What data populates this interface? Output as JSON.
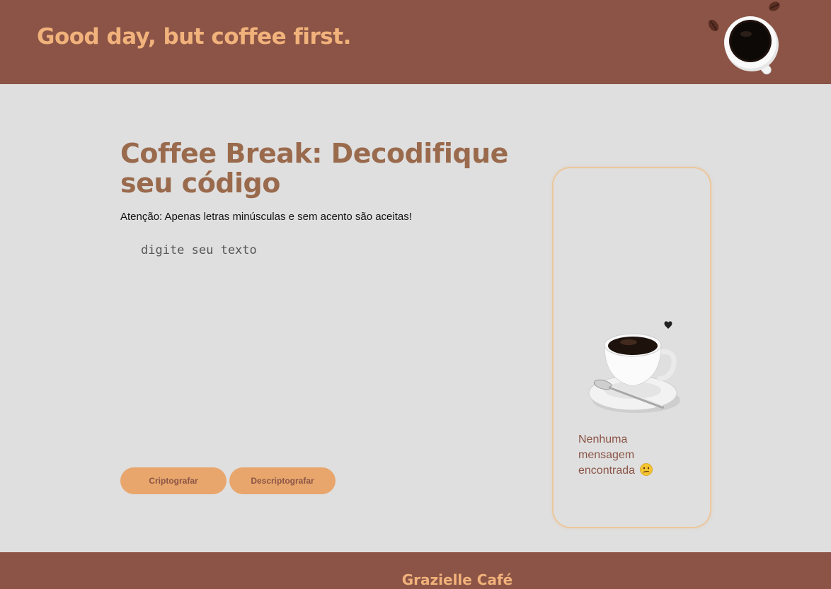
{
  "header": {
    "title": "Good day, but coffee first.",
    "logo_icon": "coffee-cup-top-view"
  },
  "main": {
    "title": "Coffee Break: Decodifique seu código",
    "warning": "Atenção: Apenas letras minúsculas e sem acento são aceitas!",
    "input": {
      "placeholder": "digite seu texto",
      "value": ""
    },
    "buttons": {
      "encrypt_label": "Criptografar",
      "decrypt_label": "Descriptografar"
    }
  },
  "result": {
    "image_icon": "coffee-cup-saucer",
    "message": "Nenhuma mensagem encontrada",
    "emoji_icon": "confused-face"
  },
  "footer": {
    "title": "Grazielle Café"
  },
  "colors": {
    "brand_brown": "#8b5446",
    "accent_orange": "#f2b27b",
    "button_bg": "#e8a66c",
    "title_brown": "#9a6a4d",
    "page_bg": "#dfdfdf",
    "card_border": "#ecc79c"
  }
}
